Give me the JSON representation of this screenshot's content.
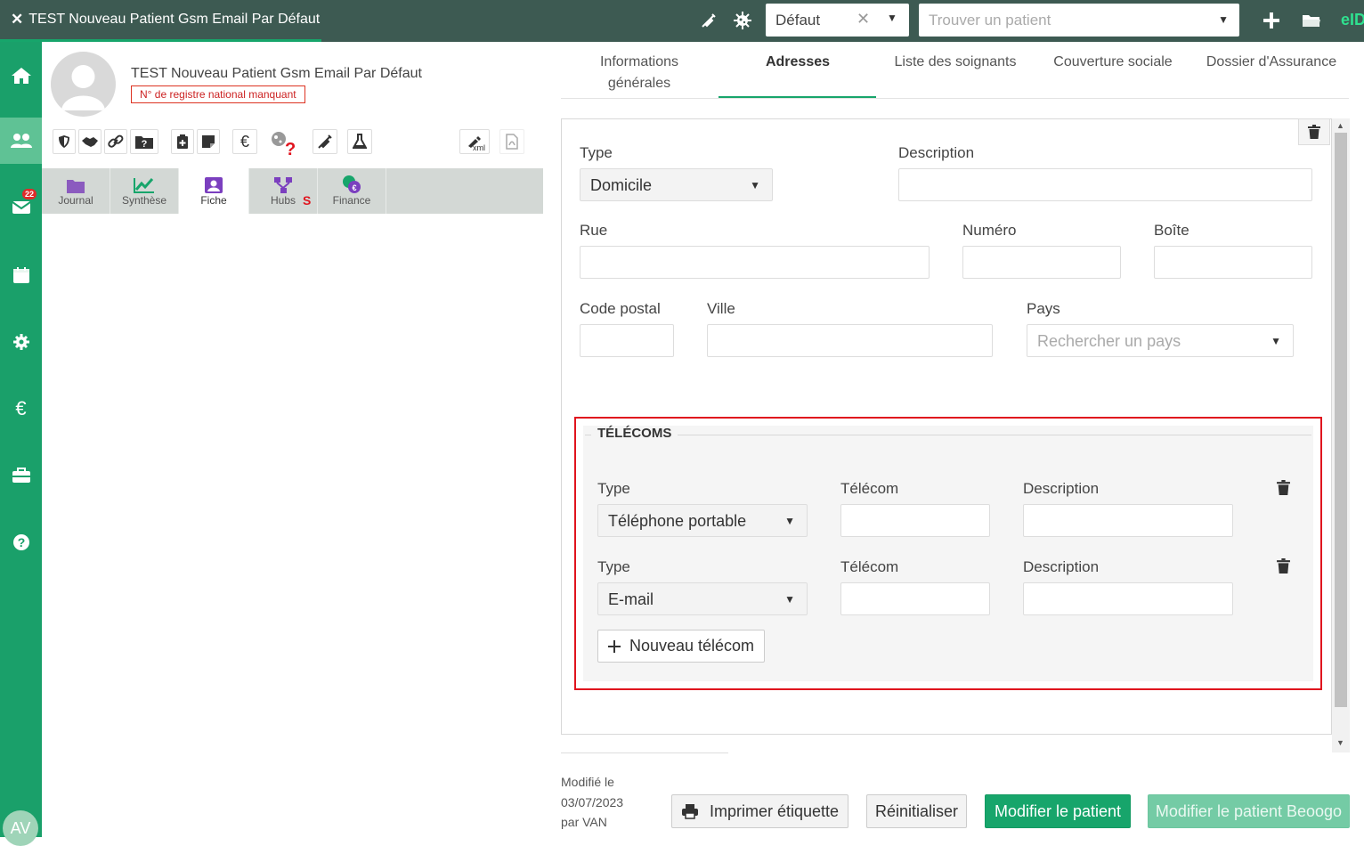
{
  "window": {
    "title": "TEST Nouveau Patient Gsm Email Par Défaut",
    "close_icon": "close-icon"
  },
  "topbar": {
    "profile_select": "Défaut",
    "search_placeholder": "Trouver un patient",
    "eid_label": "eID",
    "icons": [
      "syringe-icon",
      "virus-icon",
      "plus-icon",
      "folder-icon"
    ]
  },
  "sidebar": {
    "items": [
      "home-icon",
      "users-icon",
      "mail-icon",
      "calendar-icon",
      "gear-icon",
      "euro-icon",
      "toolbox-icon",
      "help-icon"
    ],
    "mail_badge": "22",
    "user_initials": "AV"
  },
  "patient": {
    "name": "TEST Nouveau Patient Gsm Email Par Défaut",
    "warning": "N° de registre national manquant"
  },
  "patient_toolbar": {
    "euro_label": "€",
    "xml_label": "xml",
    "unknown_mark": "?"
  },
  "left_tabs": [
    {
      "label": "Journal"
    },
    {
      "label": "Synthèse"
    },
    {
      "label": "Fiche"
    },
    {
      "label": "Hubs",
      "suffix": "S"
    },
    {
      "label": "Finance"
    }
  ],
  "right_tabs": [
    {
      "label": "Informations générales"
    },
    {
      "label": "Adresses"
    },
    {
      "label": "Liste des soignants"
    },
    {
      "label": "Couverture sociale"
    },
    {
      "label": "Dossier d'Assurance"
    }
  ],
  "address": {
    "type_label": "Type",
    "type_value": "Domicile",
    "description_label": "Description",
    "description_value": "",
    "street_label": "Rue",
    "number_label": "Numéro",
    "box_label": "Boîte",
    "postal_label": "Code postal",
    "city_label": "Ville",
    "country_label": "Pays",
    "country_placeholder": "Rechercher un pays"
  },
  "telecoms": {
    "legend": "TÉLÉCOMS",
    "rows": [
      {
        "type_label": "Type",
        "type_value": "Téléphone portable",
        "telecom_label": "Télécom",
        "description_label": "Description"
      },
      {
        "type_label": "Type",
        "type_value": "E-mail",
        "telecom_label": "Télécom",
        "description_label": "Description"
      }
    ],
    "new_button": "Nouveau télécom"
  },
  "footer": {
    "modified_line1": "Modifié le",
    "modified_date": "03/07/2023",
    "modified_by": "par VAN",
    "print_button": "Imprimer étiquette",
    "reset_button": "Réinitialiser",
    "save_button": "Modifier le patient",
    "save_beoogo_button": "Modifier le patient Beoogo"
  },
  "colors": {
    "brand_green": "#17a56b",
    "topbar": "#3d5a52",
    "highlight": "#e0141e"
  }
}
